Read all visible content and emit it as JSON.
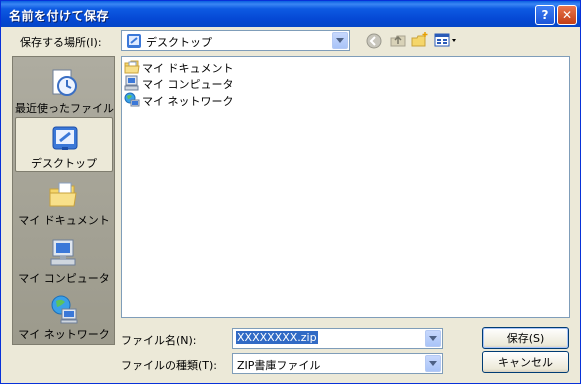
{
  "window": {
    "title": "名前を付けて保存",
    "help_glyph": "?",
    "close_glyph": "✕"
  },
  "location": {
    "label": "保存する場所(I):",
    "value": "デスクトップ"
  },
  "places": [
    {
      "label": "最近使ったファイル",
      "icon": "recent-documents-icon",
      "selected": false
    },
    {
      "label": "デスクトップ",
      "icon": "desktop-icon",
      "selected": true
    },
    {
      "label": "マイ ドキュメント",
      "icon": "my-documents-icon",
      "selected": false
    },
    {
      "label": "マイ コンピュータ",
      "icon": "my-computer-icon",
      "selected": false
    },
    {
      "label": "マイ ネットワーク",
      "icon": "my-network-icon",
      "selected": false
    }
  ],
  "files": [
    {
      "name": "マイ ドキュメント",
      "icon": "folder-icon"
    },
    {
      "name": "マイ コンピュータ",
      "icon": "computer-icon"
    },
    {
      "name": "マイ ネットワーク",
      "icon": "network-icon"
    }
  ],
  "filename": {
    "label": "ファイル名(N):",
    "value": "XXXXXXXX.zip"
  },
  "filetype": {
    "label": "ファイルの種類(T):",
    "value": "ZIP書庫ファイル"
  },
  "buttons": {
    "save": "保存(S)",
    "cancel": "キャンセル"
  },
  "colors": {
    "title_bar": "#0548d4",
    "dialog_bg": "#ece9d8",
    "places_bar": "#9f9d8b",
    "selection": "#316ac5"
  }
}
